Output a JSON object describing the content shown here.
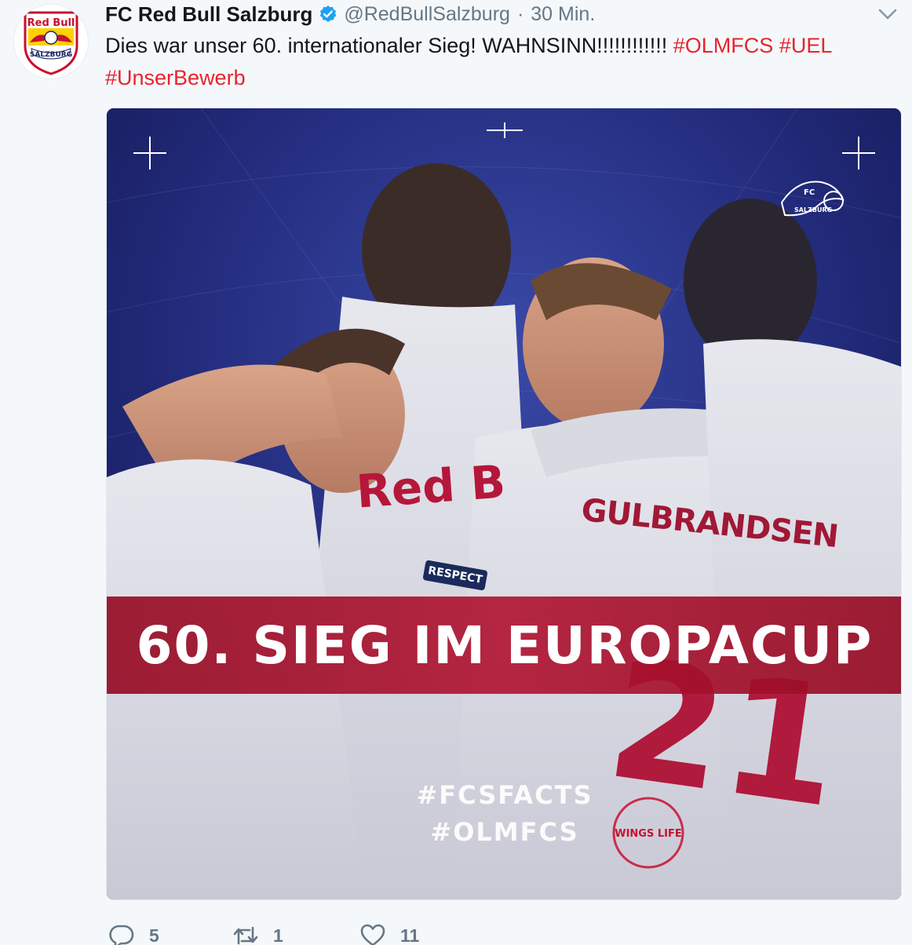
{
  "tweet": {
    "display_name": "FC Red Bull Salzburg",
    "handle": "@RedBullSalzburg",
    "separator": "·",
    "time": "30 Min.",
    "text_main": "Dies war unser 60. internationaler Sieg! WAHNSINN!!!!!!!!!!!! ",
    "hashtags": [
      "#OLMFCS",
      "#UEL",
      "#UnserBewerb"
    ],
    "avatar_text_top": "Red Bull",
    "avatar_text_bottom": "SALZBURG",
    "media": {
      "banner_text": "60. SIEG IM EUROPACUP",
      "tag_line_1": "#FCSFACTS",
      "tag_line_2": "#OLMFCS",
      "jersey_name": "GULBRANDSEN",
      "jersey_number": "21",
      "shirt_brand": "Red B",
      "patch_text": "RESPECT",
      "crest_text_top": "FC",
      "crest_text_bottom": "SALZBURG",
      "badge_text": "WINGS LIFE"
    },
    "actions": {
      "replies": "5",
      "retweets": "1",
      "likes": "11"
    }
  },
  "colors": {
    "accent_hashtag": "#e8232e",
    "verified_blue": "#1da1f2",
    "muted_text": "#657786",
    "banner_red": "#a8102e",
    "media_navy": "#1c2467"
  },
  "icons": [
    "verified-badge-icon",
    "chevron-down-icon",
    "reply-icon",
    "retweet-icon",
    "like-icon"
  ]
}
